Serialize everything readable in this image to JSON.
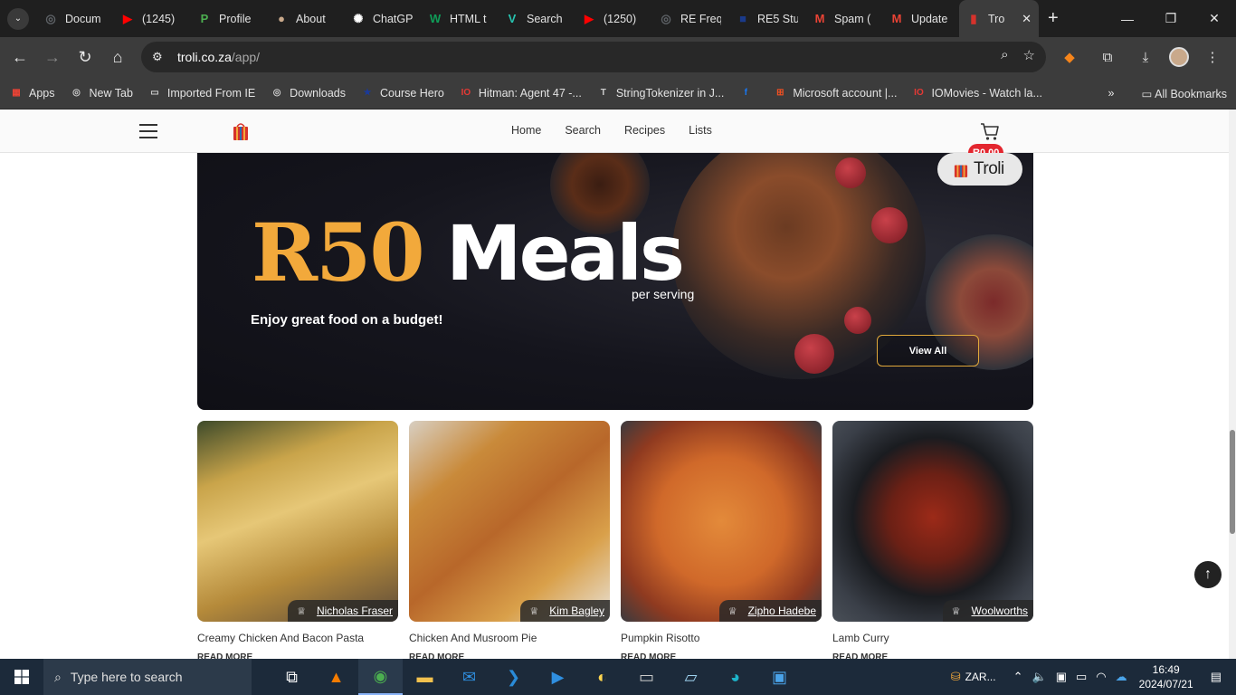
{
  "browser": {
    "tabs": [
      {
        "title": "Docum",
        "fav_color": "#5f6368",
        "fav_glyph": "◎"
      },
      {
        "title": "(1245)",
        "fav_color": "#ff0000",
        "fav_glyph": "▶"
      },
      {
        "title": "Profile",
        "fav_color": "#4caf50",
        "fav_glyph": "P"
      },
      {
        "title": "About",
        "fav_color": "#c9a98b",
        "fav_glyph": "●"
      },
      {
        "title": "ChatGP",
        "fav_color": "#ffffff",
        "fav_glyph": "✺"
      },
      {
        "title": "HTML t",
        "fav_color": "#0f9d58",
        "fav_glyph": "W"
      },
      {
        "title": "Search",
        "fav_color": "#27c4b0",
        "fav_glyph": "V"
      },
      {
        "title": "(1250)",
        "fav_color": "#ff0000",
        "fav_glyph": "▶"
      },
      {
        "title": "RE Freq",
        "fav_color": "#5f6368",
        "fav_glyph": "◎"
      },
      {
        "title": "RE5 Stu",
        "fav_color": "#1a3a8a",
        "fav_glyph": "■"
      },
      {
        "title": "Spam (",
        "fav_color": "#ea4335",
        "fav_glyph": "M"
      },
      {
        "title": "Update",
        "fav_color": "#ea4335",
        "fav_glyph": "M"
      },
      {
        "title": "Tro",
        "fav_color": "#d6322b",
        "fav_glyph": "▮"
      }
    ],
    "url_host": "troli.co.za",
    "url_path": "/app/",
    "bookmarks": [
      {
        "label": "Apps",
        "icon": "apps-grid-icon",
        "color": "#ea4335",
        "glyph": "▦"
      },
      {
        "label": "New Tab",
        "icon": "globe-icon",
        "color": "#cfcfcf",
        "glyph": "◎"
      },
      {
        "label": "Imported From IE",
        "icon": "folder-icon",
        "color": "#cfcfcf",
        "glyph": "▭"
      },
      {
        "label": "Downloads",
        "icon": "globe-icon",
        "color": "#cfcfcf",
        "glyph": "◎"
      },
      {
        "label": "Course Hero",
        "icon": "star-icon",
        "color": "#1a3a9a",
        "glyph": "★"
      },
      {
        "label": "Hitman: Agent 47 -...",
        "icon": "io-icon",
        "color": "#e53935",
        "glyph": "IO"
      },
      {
        "label": "StringTokenizer in J...",
        "icon": "text-icon",
        "color": "#cfcfcf",
        "glyph": "T"
      },
      {
        "label": "",
        "icon": "facebook-icon",
        "color": "#1877f2",
        "glyph": "f"
      },
      {
        "label": "Microsoft account |...",
        "icon": "microsoft-icon",
        "color": "#f25022",
        "glyph": "⊞"
      },
      {
        "label": "IOMovies - Watch la...",
        "icon": "io-icon",
        "color": "#e53935",
        "glyph": "IO"
      }
    ],
    "all_bookmarks_label": "All Bookmarks"
  },
  "site": {
    "nav_links": [
      "Home",
      "Search",
      "Recipes",
      "Lists"
    ],
    "cart_total": "R0.00",
    "brand_name": "Troli",
    "hero": {
      "price": "R50",
      "word": "Meals",
      "per": "per serving",
      "tagline": "Enjoy great food on a budget!",
      "button": "View All"
    },
    "recipes": [
      {
        "title": "Creamy Chicken And Bacon Pasta",
        "author": "Nicholas Fraser",
        "read_more": "READ MORE",
        "bg": "linear-gradient(160deg,#3d4a2a 0%,#c9a44a 25%,#e6c777 45%,#b58a3a 70%,#5b4a3a 100%)"
      },
      {
        "title": "Chicken And Musroom Pie",
        "author": "Kim Bagley",
        "read_more": "READ MORE",
        "bg": "linear-gradient(140deg,#d8cfc2 0%,#c98a3a 25%,#b8672a 50%,#d9a04a 75%,#e8e2d8 100%)"
      },
      {
        "title": "Pumpkin Risotto",
        "author": "Zipho Hadebe",
        "read_more": "READ MORE",
        "bg": "radial-gradient(circle at 50% 50%,#e38a3a 0%,#d0692a 45%,#8f3a20 75%,#3a3a3f 100%)"
      },
      {
        "title": "Lamb Curry",
        "author": "Woolworths",
        "read_more": "READ MORE",
        "bg": "radial-gradient(circle at 50% 48%,#9c2a18 0%,#6b2015 30%,#1a1c20 55%,#3a3f48 80%,#4a5058 100%)"
      }
    ]
  },
  "taskbar": {
    "search_placeholder": "Type here to search",
    "currency": "ZAR...",
    "time": "16:49",
    "date": "2024/07/21"
  }
}
